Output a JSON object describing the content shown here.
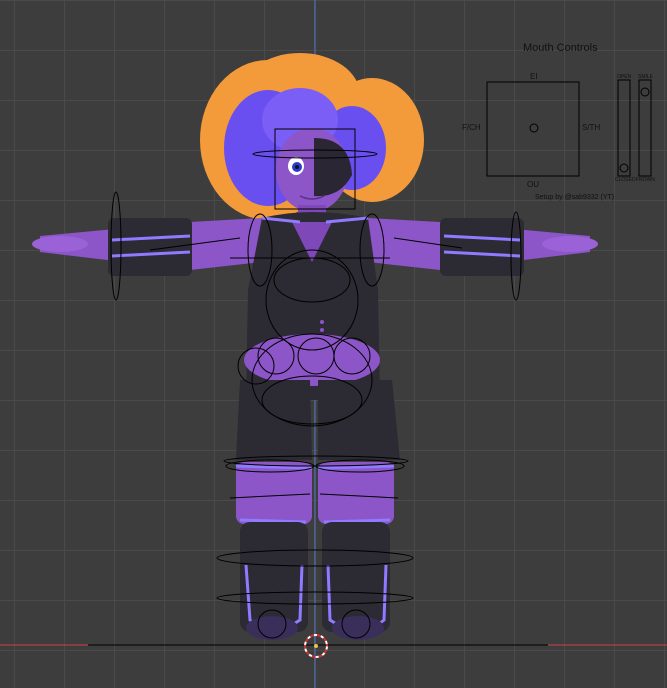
{
  "viewport": {
    "background": "#3d3d3d",
    "axis_y_color": "#4f6fb0",
    "axis_x_color": "#b0404a",
    "origin_marker_color": "#ffffff"
  },
  "mouth_controls": {
    "title": "Mouth Controls",
    "label_top": "EI",
    "label_left": "F/CH",
    "label_right": "S/TH",
    "label_bottom": "OU",
    "slider1_top": "OPEN",
    "slider1_bottom": "CLOSED",
    "slider2_top": "SMILE",
    "slider2_bottom": "FROWN",
    "credit": "Setup by @sab9332 (YT)"
  },
  "character": {
    "hair_color": "#f39a3a",
    "hair_inner_color": "#6a4ff0",
    "skin_color": "#8c55c8",
    "outfit_color": "#2c2a33",
    "glow_color": "#8e7bff"
  }
}
